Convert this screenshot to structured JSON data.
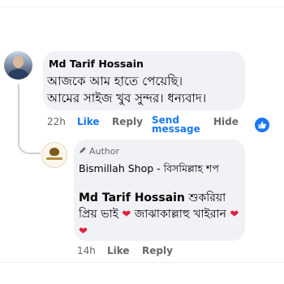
{
  "comment": {
    "author": "Md Tarif Hossain",
    "text_line1": "আজকে আম হাতে পেয়েছি।",
    "text_line2": "আমের সাইজ খুব সুন্দর। ধন্যবাদ।",
    "time": "22h",
    "like_label": "Like",
    "reply_label": "Reply",
    "send_label_line1": "Send",
    "send_label_line2": "message",
    "hide_label": "Hide",
    "reaction_icon": "like-icon"
  },
  "reply": {
    "author_badge": "Author",
    "author_name": "Bismillah Shop - বিসমিল্লাহ শপ",
    "mention": "Md Tarif Hossain",
    "text_part1": " শুকরিয়া প্রিয় ভাই ",
    "text_part2": " জাঝাকাল্লাহু খাইরান ",
    "heart": "❤",
    "hearts": "❤❤",
    "time": "14h",
    "like_label": "Like",
    "reply_label": "Reply"
  },
  "colors": {
    "link_blue": "#1877f2",
    "bubble_bg": "#f0f2f5",
    "muted": "#65676b",
    "heart": "#e41e3f"
  }
}
